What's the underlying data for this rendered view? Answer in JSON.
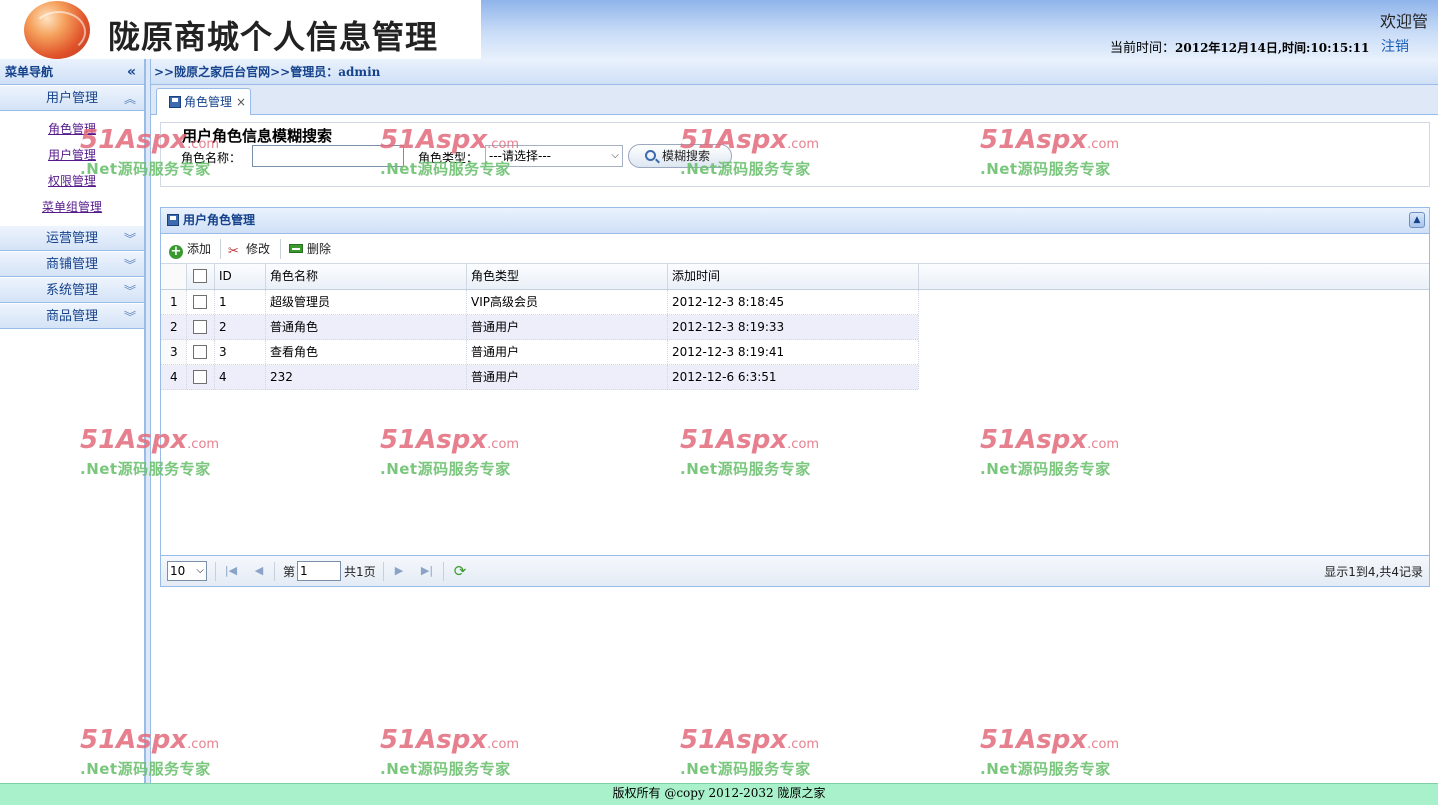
{
  "header": {
    "title": "陇原商城个人信息管理",
    "welcome": "欢迎管",
    "time_label": "当前时间：",
    "time_value": "2012年12月14日,时间:10:15:11",
    "logout": "注销"
  },
  "sidebar": {
    "title": "菜单导航",
    "collapse_icon": "double-chevron-left-icon",
    "user_group": {
      "label": "用户管理",
      "links": [
        "角色管理",
        "用户管理",
        "权限管理",
        "菜单组管理"
      ]
    },
    "groups": [
      "运营管理",
      "商铺管理",
      "系统管理",
      "商品管理"
    ]
  },
  "breadcrumb": ">>陇原之家后台官网>>管理员：admin",
  "tab": {
    "label": "角色管理",
    "close": "×"
  },
  "search": {
    "title": "用户角色信息模糊搜索",
    "name_label": "角色名称：",
    "name_value": "",
    "type_label": "角色类型：",
    "type_selected": "---请选择---",
    "button": "模糊搜索"
  },
  "grid_panel": {
    "title": "用户角色管理",
    "toolbar": {
      "add": "添加",
      "edit": "修改",
      "delete": "删除"
    },
    "columns": {
      "id": "ID",
      "name": "角色名称",
      "type": "角色类型",
      "time": "添加时间"
    },
    "rows": [
      {
        "rn": "1",
        "id": "1",
        "name": "超级管理员",
        "type": "VIP高级会员",
        "time": "2012-12-3 8:18:45"
      },
      {
        "rn": "2",
        "id": "2",
        "name": "普通角色",
        "type": "普通用户",
        "time": "2012-12-3 8:19:33"
      },
      {
        "rn": "3",
        "id": "3",
        "name": "查看角色",
        "type": "普通用户",
        "time": "2012-12-3 8:19:41"
      },
      {
        "rn": "4",
        "id": "4",
        "name": "232",
        "type": "普通用户",
        "time": "2012-12-6 6:3:51"
      }
    ],
    "pager": {
      "page_size": "10",
      "page_prefix": "第",
      "page_value": "1",
      "page_suffix": "共1页",
      "info": "显示1到4,共4记录"
    }
  },
  "watermark": {
    "brand": "51Aspx",
    "domain": ".com",
    "tagline": ".Net源码服务专家"
  },
  "footer": "版权所有 @copy 2012-2032 陇原之家",
  "colors": {
    "header_blue": "#8fb4ea",
    "panel_border": "#99bbe8",
    "title_text": "#15428b",
    "footer_green": "#a9f1cb",
    "alt_row": "#eeeefb"
  }
}
